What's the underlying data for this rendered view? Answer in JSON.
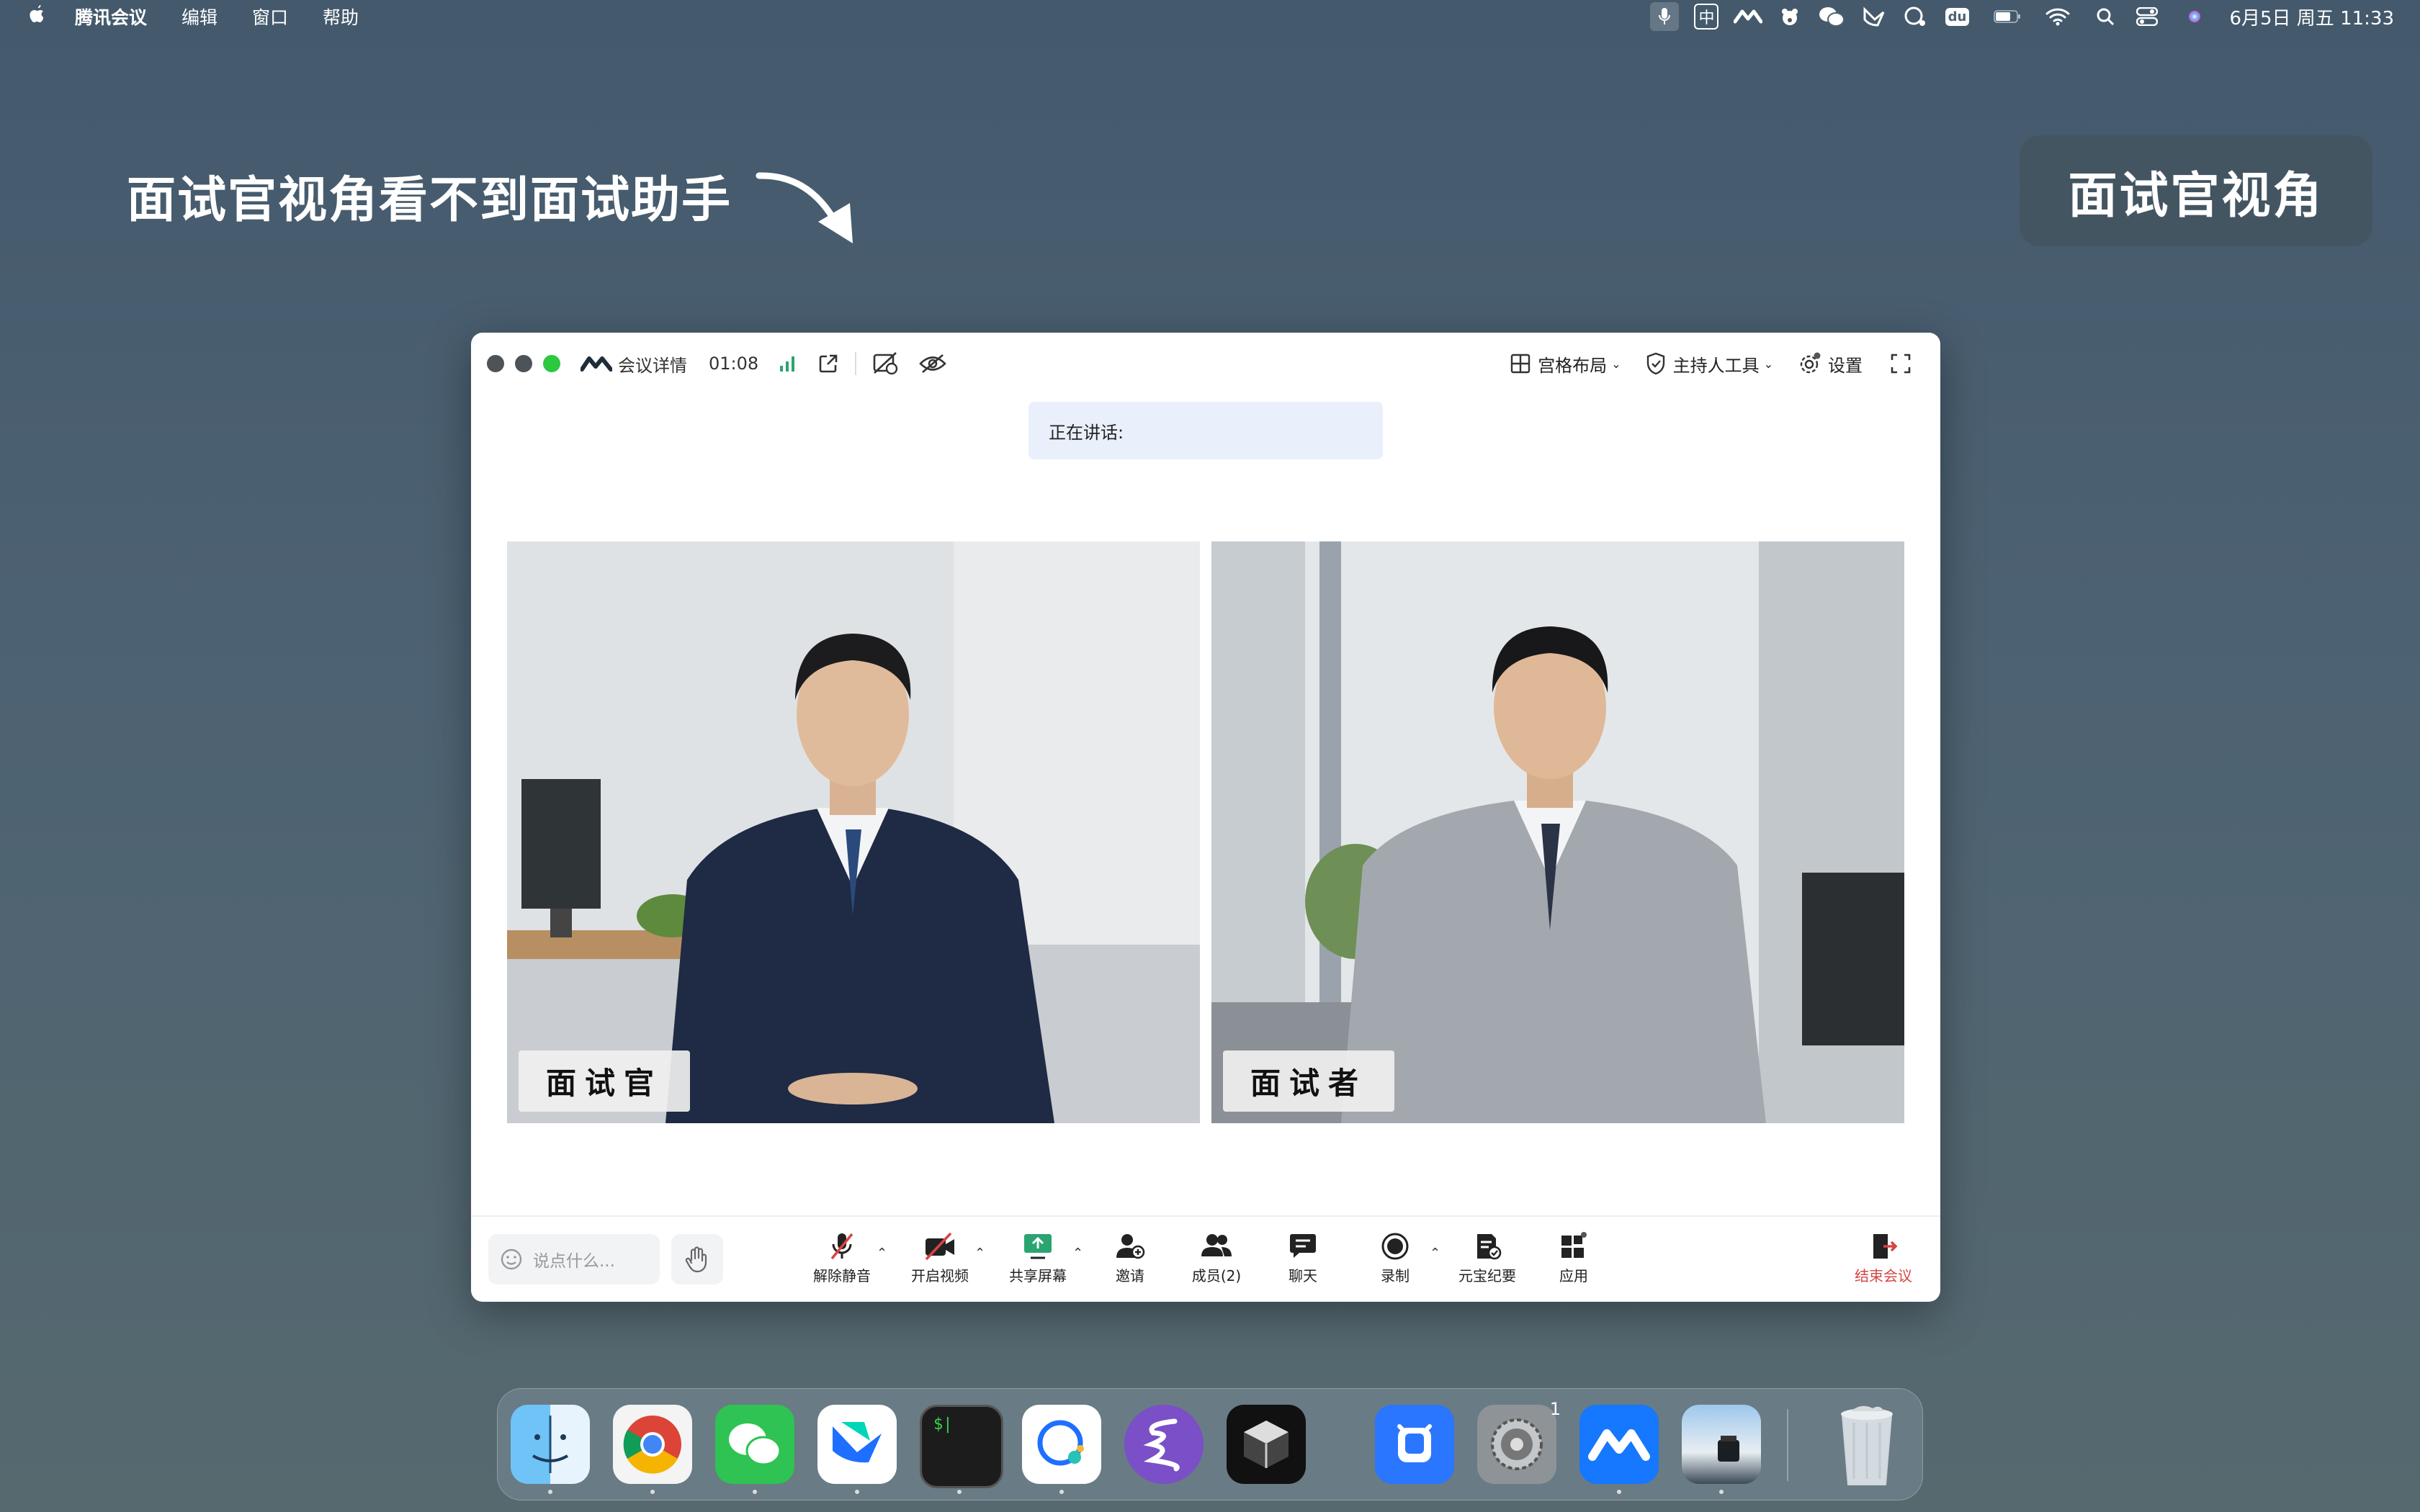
{
  "menubar": {
    "apple": "",
    "app_name": "腾讯会议",
    "menus": [
      "编辑",
      "窗口",
      "帮助"
    ],
    "input_method": "中",
    "datetime": "6月5日 周五  11:33",
    "icons": [
      "microphone-icon",
      "input-method-icon",
      "tencent-meeting-icon",
      "bear-icon",
      "wechat-icon",
      "feishu-icon",
      "chat-search-icon",
      "du-icon",
      "battery-icon",
      "wifi-icon",
      "spotlight-icon",
      "control-center-icon",
      "siri-icon"
    ]
  },
  "annotation": {
    "caption": "面试官视角看不到面试助手",
    "badge": "面试官视角"
  },
  "meeting": {
    "titlebar": {
      "details": "会议详情",
      "timer": "01:08",
      "layout": "宫格布局",
      "host_tools": "主持人工具",
      "settings": "设置"
    },
    "speaking_label": "正在讲话:",
    "tiles": [
      {
        "label": "面试官"
      },
      {
        "label": "面试者"
      }
    ],
    "bottom": {
      "chat_placeholder": "说点什么...",
      "tools": {
        "unmute": "解除静音",
        "video": "开启视频",
        "share": "共享屏幕",
        "invite": "邀请",
        "members": "成员(2)",
        "chat": "聊天",
        "record": "录制",
        "minutes": "元宝纪要",
        "apps": "应用",
        "end": "结束会议"
      }
    },
    "colors": {
      "accent_green": "#2ba471",
      "end_red": "#d64541",
      "speaking_bg": "#eaf0fb"
    }
  },
  "dock": {
    "apps": [
      "Finder",
      "Chrome",
      "WeChat",
      "Feishu",
      "Terminal",
      "Chat",
      "Emacs",
      "Cursor",
      "Tencent Docs",
      "System Settings",
      "Tencent Meeting",
      "Preview",
      "Trash"
    ],
    "settings_badge": "1"
  }
}
